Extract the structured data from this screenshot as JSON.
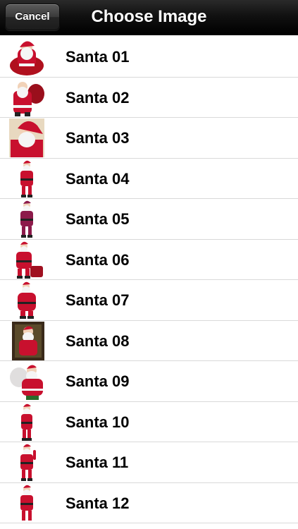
{
  "navbar": {
    "cancel_label": "Cancel",
    "title": "Choose Image"
  },
  "items": [
    {
      "label": "Santa 01",
      "icon": "santa-seated-icon"
    },
    {
      "label": "Santa 02",
      "icon": "santa-sack-icon"
    },
    {
      "label": "Santa 03",
      "icon": "santa-portrait-icon"
    },
    {
      "label": "Santa 04",
      "icon": "santa-standing-icon"
    },
    {
      "label": "Santa 05",
      "icon": "santa-standing-icon"
    },
    {
      "label": "Santa 06",
      "icon": "santa-standing-icon"
    },
    {
      "label": "Santa 07",
      "icon": "santa-standing-icon"
    },
    {
      "label": "Santa 08",
      "icon": "santa-fireplace-icon"
    },
    {
      "label": "Santa 09",
      "icon": "santa-sack-icon"
    },
    {
      "label": "Santa 10",
      "icon": "santa-standing-icon"
    },
    {
      "label": "Santa 11",
      "icon": "santa-standing-icon"
    },
    {
      "label": "Santa 12",
      "icon": "santa-standing-icon"
    }
  ],
  "colors": {
    "navbar_bg": "#111111",
    "row_separator": "#d9d9d9",
    "santa_red": "#c8102e",
    "santa_white": "#f5f5f5"
  }
}
